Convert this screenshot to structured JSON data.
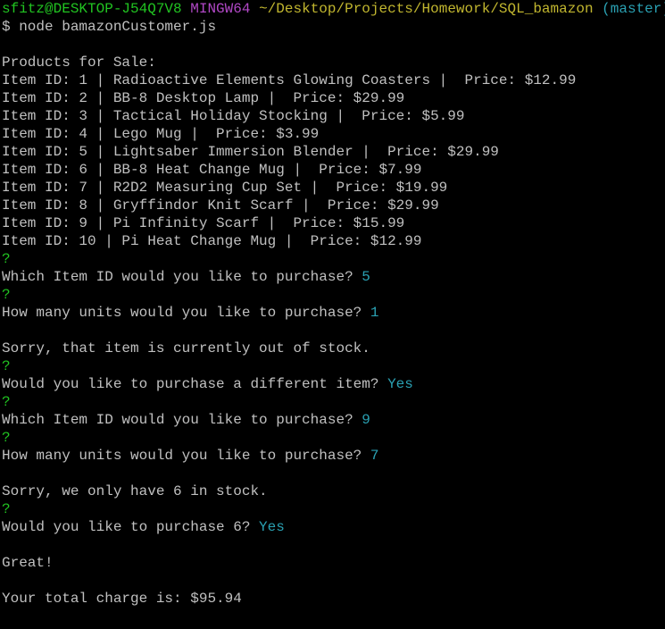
{
  "prompt": {
    "user_host": "sfitz@DESKTOP-J54Q7V8",
    "shell": "MINGW64",
    "path": "~/Desktop/Projects/Homework/SQL_bamazon",
    "branch": "(master)",
    "command": "$ node bamazonCustomer.js"
  },
  "catalog": {
    "heading": "Products for Sale:",
    "items": [
      "Item ID: 1 | Radioactive Elements Glowing Coasters |  Price: $12.99",
      "Item ID: 2 | BB-8 Desktop Lamp |  Price: $29.99",
      "Item ID: 3 | Tactical Holiday Stocking |  Price: $5.99",
      "Item ID: 4 | Lego Mug |  Price: $3.99",
      "Item ID: 5 | Lightsaber Immersion Blender |  Price: $29.99",
      "Item ID: 6 | BB-8 Heat Change Mug |  Price: $7.99",
      "Item ID: 7 | R2D2 Measuring Cup Set |  Price: $19.99",
      "Item ID: 8 | Gryffindor Knit Scarf |  Price: $29.99",
      "Item ID: 9 | Pi Infinity Scarf |  Price: $15.99",
      "Item ID: 10 | Pi Heat Change Mug |  Price: $12.99"
    ]
  },
  "session": {
    "q_mark": "?",
    "q1_text": "Which Item ID would you like to purchase? ",
    "q1_answer": "5",
    "q2_text": "How many units would you like to purchase? ",
    "q2_answer": "1",
    "msg_out_of_stock": "Sorry, that item is currently out of stock.",
    "q3_text": "Would you like to purchase a different item? ",
    "q3_answer": "Yes",
    "q4_text": "Which Item ID would you like to purchase? ",
    "q4_answer": "9",
    "q5_text": "How many units would you like to purchase? ",
    "q5_answer": "7",
    "msg_limited": "Sorry, we only have 6 in stock.",
    "q6_text": "Would you like to purchase 6? ",
    "q6_answer": "Yes",
    "msg_great": "Great!",
    "msg_total": "Your total charge is: $95.94"
  },
  "colors": {
    "background": "#000000",
    "text": "#c0c0c0",
    "prompt_user": "#21c421",
    "prompt_shell": "#b148c6",
    "prompt_path": "#c1b62f",
    "answer": "#2aa1b3"
  }
}
